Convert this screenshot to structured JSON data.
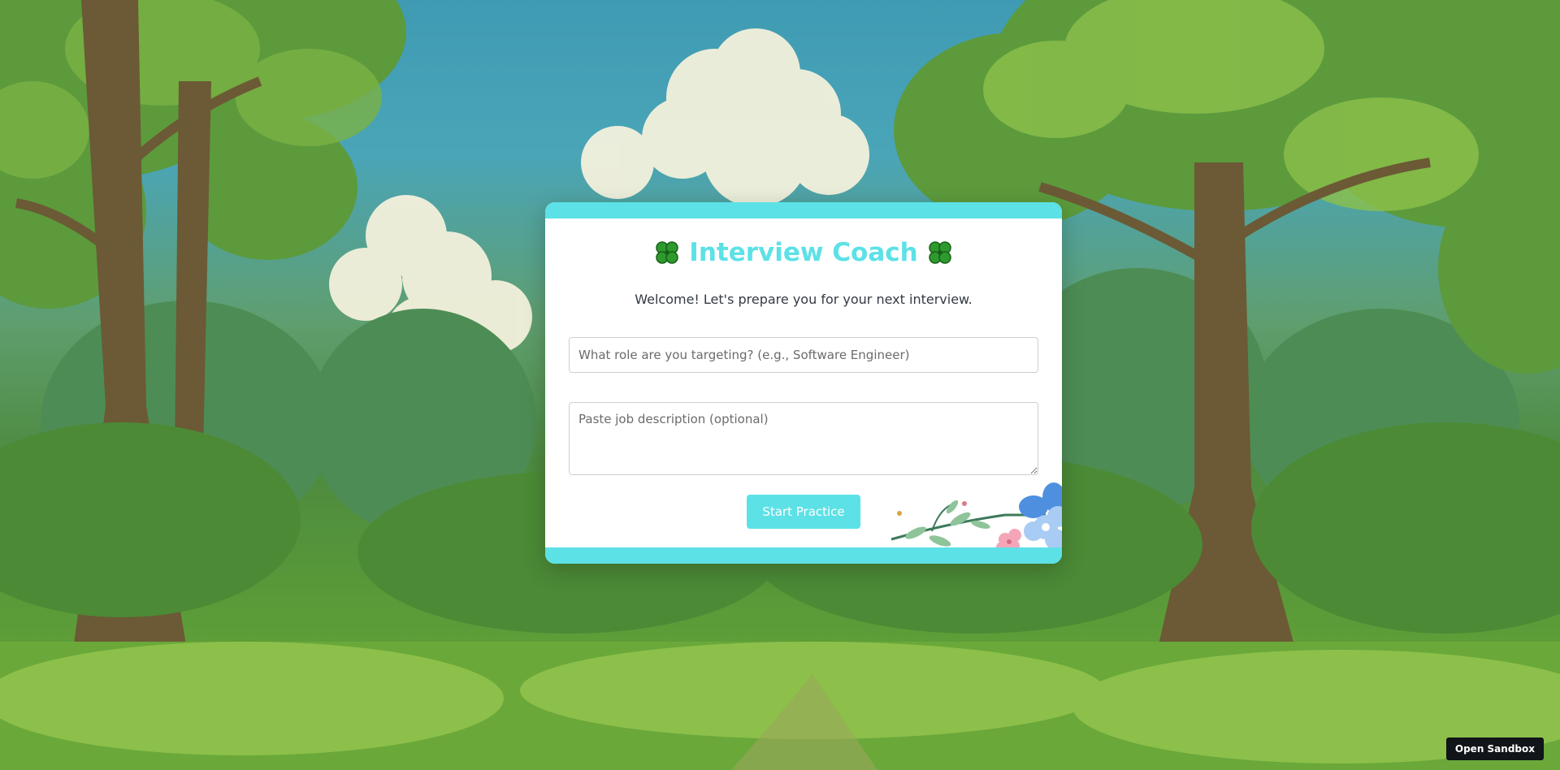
{
  "background": {
    "description_colors": {
      "sky": "#3f9bb3",
      "foliage_dark": "#3d7a34",
      "foliage_light": "#8cc04a",
      "trunk": "#6b5a35",
      "cloud": "#f3f1dc"
    }
  },
  "card": {
    "accent_color": "#5ce1e6",
    "title": "Interview Coach",
    "title_icon": "four-leaf-clover-icon",
    "subtitle": "Welcome! Let's prepare you for your next interview.",
    "role_input": {
      "value": "",
      "placeholder": "What role are you targeting? (e.g., Software Engineer)"
    },
    "job_description": {
      "value": "",
      "placeholder": "Paste job description (optional)"
    },
    "start_button_label": "Start Practice",
    "decoration_icon": "floral-branch-icon"
  },
  "sandbox": {
    "button_label": "Open Sandbox"
  }
}
